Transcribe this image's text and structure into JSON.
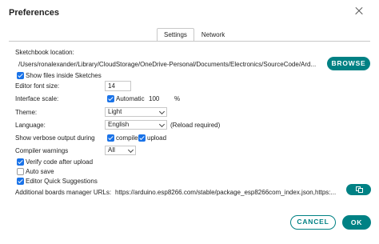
{
  "window": {
    "title": "Preferences"
  },
  "tabs": [
    {
      "label": "Settings",
      "active": true
    },
    {
      "label": "Network",
      "active": false
    }
  ],
  "sketchbook": {
    "label": "Sketchbook location:",
    "path": "/Users/ronalexander/Library/CloudStorage/OneDrive-Personal/Documents/Electronics/SourceCode/Ard...",
    "browse_label": "BROWSE",
    "show_files_label": "Show files inside Sketches",
    "show_files_checked": true
  },
  "editor_font_size": {
    "label": "Editor font size:",
    "value": "14"
  },
  "interface_scale": {
    "label": "Interface scale:",
    "automatic_label": "Automatic",
    "automatic_checked": true,
    "value": "100",
    "unit": "%"
  },
  "theme": {
    "label": "Theme:",
    "value": "Light"
  },
  "language": {
    "label": "Language:",
    "value": "English",
    "note": "(Reload required)"
  },
  "verbose": {
    "label": "Show verbose output during",
    "compile_label": "compile",
    "compile_checked": true,
    "upload_label": "upload",
    "upload_checked": true
  },
  "compiler_warnings": {
    "label": "Compiler warnings",
    "value": "All"
  },
  "options": [
    {
      "label": "Verify code after upload",
      "checked": true
    },
    {
      "label": "Auto save",
      "checked": false
    },
    {
      "label": "Editor Quick Suggestions",
      "checked": true
    }
  ],
  "boards_manager": {
    "label": "Additional boards manager URLs:",
    "value": "https://arduino.esp8266.com/stable/package_esp8266com_index.json,https:..."
  },
  "footer": {
    "cancel_label": "CANCEL",
    "ok_label": "OK"
  },
  "colors": {
    "accent": "#008184",
    "checkbox": "#1a73e8"
  }
}
